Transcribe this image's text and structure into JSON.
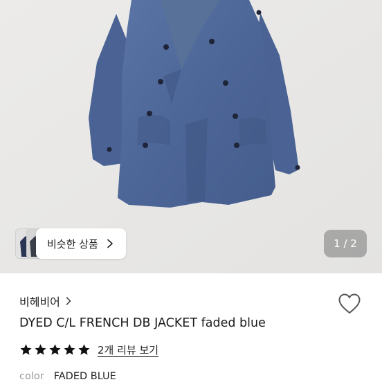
{
  "gallery": {
    "photo_icon": "jacket-photo",
    "similar_label": "비슷한 상품",
    "similar_icon": "chevron-right-icon",
    "page_counter": "1 / 2",
    "background_color": "#e9e8e6",
    "jacket_color": "#4e6899"
  },
  "product": {
    "shop_name": "비헤비어",
    "shop_chevron_icon": "chevron-right-icon",
    "wishlist_icon": "heart-icon",
    "title": "DYED C/L FRENCH DB JACKET faded blue",
    "rating": {
      "stars": 5,
      "max": 5,
      "star_icon": "star-icon"
    },
    "review_link": "2개 리뷰 보기",
    "attributes": [
      {
        "key": "color",
        "value": "FADED BLUE"
      }
    ]
  }
}
